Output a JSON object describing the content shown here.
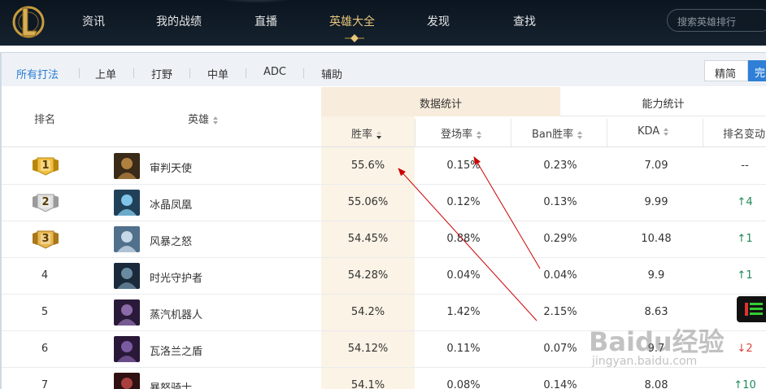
{
  "nav": {
    "items": [
      {
        "label": "资讯",
        "active": false
      },
      {
        "label": "我的战绩",
        "active": false
      },
      {
        "label": "直播",
        "active": false
      },
      {
        "label": "英雄大全",
        "active": true
      },
      {
        "label": "发现",
        "active": false
      },
      {
        "label": "查找",
        "active": false
      }
    ],
    "search_placeholder": "搜索英雄排行"
  },
  "filters": [
    "所有打法",
    "上单",
    "打野",
    "中单",
    "ADC",
    "辅助"
  ],
  "view_toggle": {
    "left": "精简",
    "right": "完"
  },
  "table": {
    "group_data": "数据统计",
    "group_ability": "能力统计",
    "headers": {
      "rank": "排名",
      "hero": "英雄",
      "win_rate": "胜率",
      "pick_rate": "登场率",
      "ban_rate": "Ban胜率",
      "kda": "KDA",
      "rank_change": "排名变动"
    },
    "rows": [
      {
        "rank": "1",
        "hero": "审判天使",
        "win_rate": "55.6%",
        "pick_rate": "0.15%",
        "ban_rate": "0.23%",
        "kda": "7.09",
        "change": "--",
        "trend": "none"
      },
      {
        "rank": "2",
        "hero": "冰晶凤凰",
        "win_rate": "55.06%",
        "pick_rate": "0.12%",
        "ban_rate": "0.13%",
        "kda": "9.99",
        "change": "4",
        "trend": "up"
      },
      {
        "rank": "3",
        "hero": "风暴之怒",
        "win_rate": "54.45%",
        "pick_rate": "0.88%",
        "ban_rate": "0.29%",
        "kda": "10.48",
        "change": "1",
        "trend": "up"
      },
      {
        "rank": "4",
        "hero": "时光守护者",
        "win_rate": "54.28%",
        "pick_rate": "0.04%",
        "ban_rate": "0.04%",
        "kda": "9.9",
        "change": "1",
        "trend": "up"
      },
      {
        "rank": "5",
        "hero": "蒸汽机器人",
        "win_rate": "54.2%",
        "pick_rate": "1.42%",
        "ban_rate": "2.15%",
        "kda": "8.63",
        "change": "",
        "trend": "none"
      },
      {
        "rank": "6",
        "hero": "瓦洛兰之盾",
        "win_rate": "54.12%",
        "pick_rate": "0.11%",
        "ban_rate": "0.07%",
        "kda": "9.7",
        "change": "2",
        "trend": "down"
      },
      {
        "rank": "7",
        "hero": "暴怒骑士",
        "win_rate": "54.1%",
        "pick_rate": "0.08%",
        "ban_rate": "0.14%",
        "kda": "8.08",
        "change": "10",
        "trend": "up"
      }
    ]
  },
  "watermark": {
    "main": "Baidu经验",
    "sub": "jingyan.baidu.com"
  },
  "colors": {
    "nav_bg": "#0b1520",
    "nav_active": "#e8c67c",
    "filter_active": "#2a7bd3",
    "trend_up": "#1e8a57",
    "trend_down": "#d9433c",
    "winrate_col_bg": "#fbf3e6",
    "annotation_arrow": "#cc0000"
  }
}
